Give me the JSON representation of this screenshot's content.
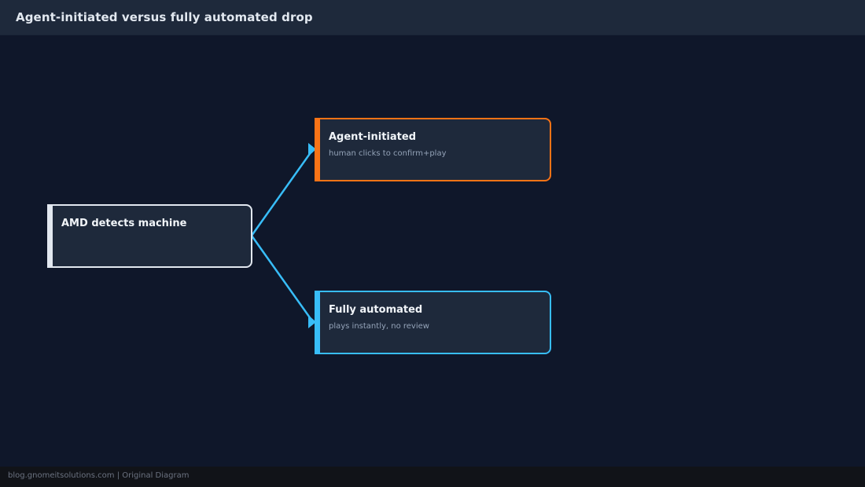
{
  "header": {
    "title": "Agent-initiated versus fully automated drop"
  },
  "nodes": {
    "source": {
      "title": "AMD detects machine",
      "subtitle": ""
    },
    "agent": {
      "title": "Agent-initiated",
      "subtitle": "human clicks to confirm+play"
    },
    "auto": {
      "title": "Fully automated",
      "subtitle": "plays instantly, no review"
    }
  },
  "edges": [
    {
      "from": "source",
      "to": "agent"
    },
    {
      "from": "source",
      "to": "auto"
    }
  ],
  "colors": {
    "background": "#0f172a",
    "panel": "#1e293b",
    "source_accent": "#e2e8f0",
    "agent_accent": "#f97316",
    "auto_accent": "#38bdf8",
    "edge": "#38bdf8"
  },
  "footer": {
    "text": "blog.gnomeitsolutions.com | Original Diagram"
  }
}
